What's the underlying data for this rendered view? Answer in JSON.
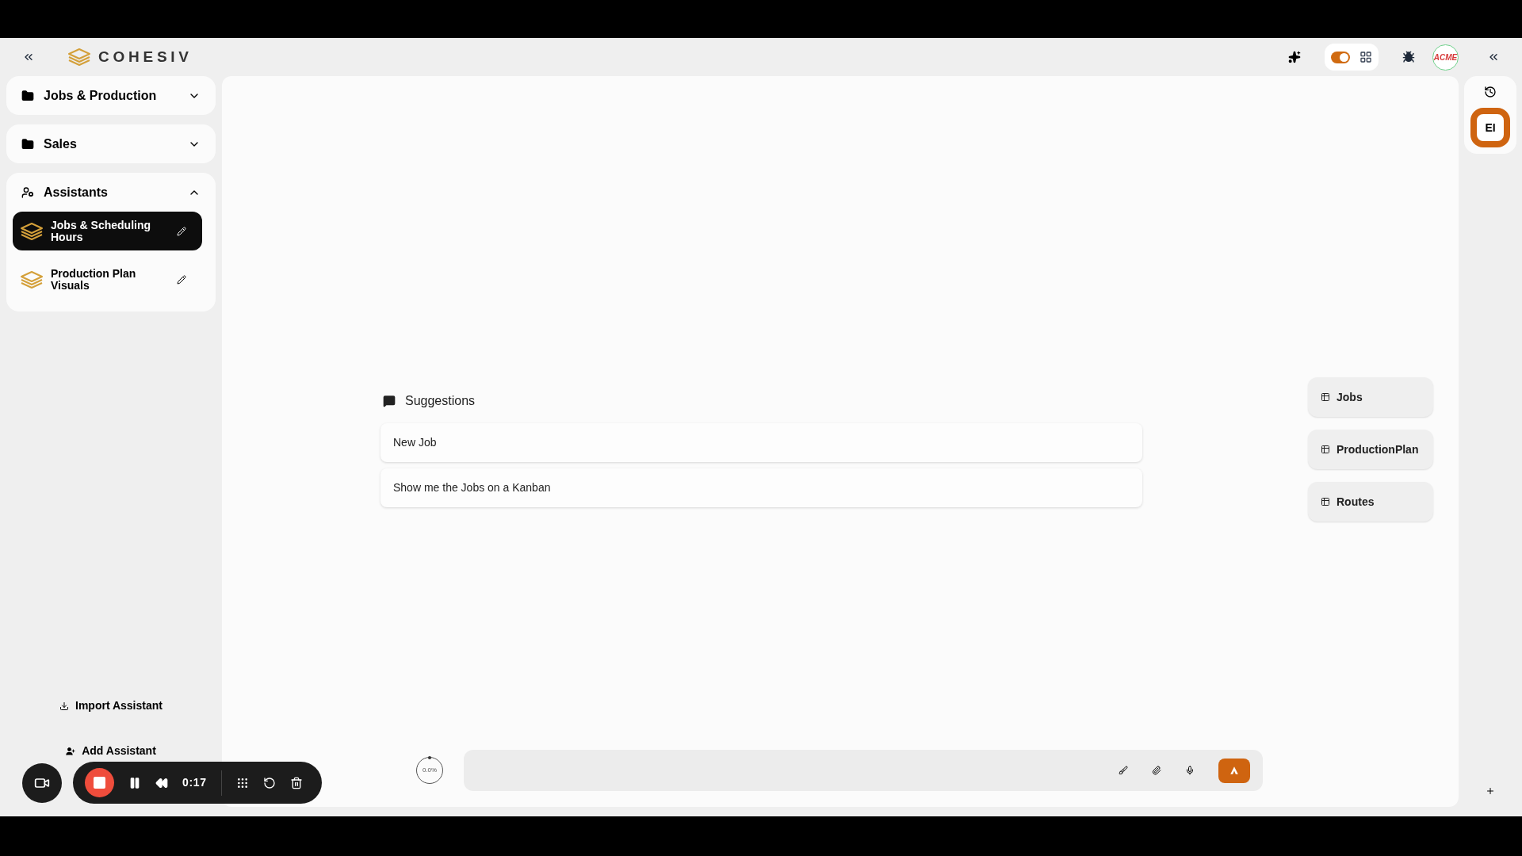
{
  "header": {
    "logo": "COHESIV",
    "toggle": {
      "on": true
    },
    "org_badge": "ACME"
  },
  "sidebar": {
    "groups": [
      {
        "label": "Jobs & Production",
        "expanded": false
      },
      {
        "label": "Sales",
        "expanded": false
      },
      {
        "label": "Assistants",
        "expanded": true,
        "items": [
          {
            "label": "Jobs & Scheduling Hours",
            "selected": true
          },
          {
            "label": "Production Plan Visuals",
            "selected": false
          }
        ]
      }
    ],
    "actions": [
      {
        "kind": "import",
        "label": "Import Assistant"
      },
      {
        "kind": "add",
        "label": "Add Assistant"
      }
    ]
  },
  "suggestions": {
    "title": "Suggestions",
    "items": [
      "New Job",
      "Show me the Jobs on a Kanban"
    ]
  },
  "tables": [
    "Jobs",
    "ProductionPlan",
    "Routes"
  ],
  "composer": {
    "usage": "0.0%"
  },
  "right_rail": {
    "avatar": "EI"
  },
  "recorder": {
    "time": "0:17"
  }
}
